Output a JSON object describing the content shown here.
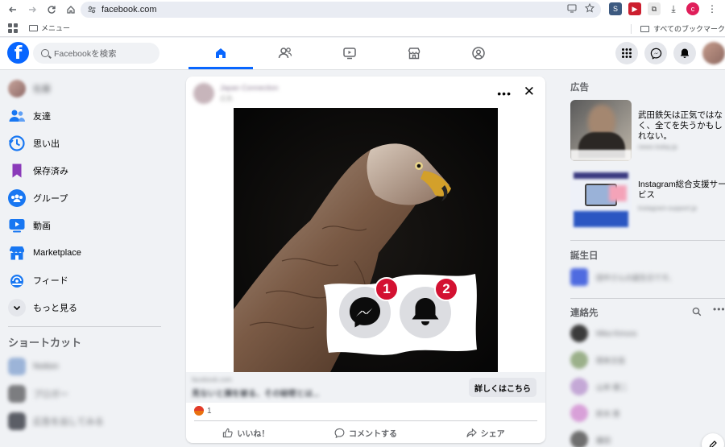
{
  "browser": {
    "url": "facebook.com",
    "bookmarks": {
      "menu_label": "メニュー",
      "all_bookmarks_label": "すべてのブックマーク"
    },
    "profile_initial": "c"
  },
  "header": {
    "logo_letter": "f",
    "search_placeholder": "Facebookを検索",
    "nav_tabs": [
      "home",
      "friends",
      "watch",
      "marketplace",
      "groups"
    ]
  },
  "left_sidebar": {
    "profile_name": "佐藤",
    "items": [
      {
        "label": "友達",
        "icon": "friends-icon",
        "color": "#1877f2"
      },
      {
        "label": "思い出",
        "icon": "memories-icon",
        "color": "#1877f2"
      },
      {
        "label": "保存済み",
        "icon": "saved-icon",
        "color": "#8a3ab9"
      },
      {
        "label": "グループ",
        "icon": "groups-icon",
        "color": "#1877f2"
      },
      {
        "label": "動画",
        "icon": "video-icon",
        "color": "#1877f2"
      },
      {
        "label": "Marketplace",
        "icon": "marketplace-icon",
        "color": "#1877f2"
      },
      {
        "label": "フィード",
        "icon": "feed-icon",
        "color": "#1877f2"
      }
    ],
    "more_label": "もっと見る",
    "shortcuts_heading": "ショートカット",
    "shortcuts": [
      "Notion",
      "ブロガー",
      "広告を出してみる"
    ]
  },
  "post": {
    "author": "Japan Connection",
    "subtitle": "広告",
    "more_label": "•••",
    "close_label": "✕",
    "cta_caption": "facebook.com",
    "cta_headline": "見ないと損を被る、その秘密とは...",
    "cta_button": "詳しくはこちら",
    "badge_messenger": "1",
    "badge_notifications": "2",
    "reaction_count": "1",
    "actions": {
      "like": "いいね！",
      "comment": "コメントする",
      "share": "シェア"
    }
  },
  "right_sidebar": {
    "ads_heading": "広告",
    "ads": [
      {
        "title": "武田鉄矢は正気ではなく、全てを失うかもしれない。",
        "sub": "news-today.jp"
      },
      {
        "title": "Instagram総合支援サービス",
        "sub": "instagram-support.jp"
      }
    ],
    "birthdays_heading": "誕生日",
    "birthday_text": "田中さんの誕生日です。",
    "contacts_heading": "連絡先",
    "contacts": [
      "Mika Kimura",
      "岡本文佳",
      "山本 健二",
      "鈴木 恵",
      "藤田"
    ]
  },
  "colors": {
    "brand": "#0866ff",
    "badge": "#d31131"
  }
}
